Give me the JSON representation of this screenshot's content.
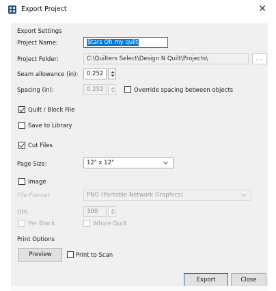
{
  "window": {
    "title": "Export Project",
    "close_glyph": "✕"
  },
  "export_settings": {
    "heading": "Export Settings",
    "project_name": {
      "label": "Project Name:",
      "value": "Stars Oh my quilt"
    },
    "project_folder": {
      "label": "Project Folder:",
      "value": "C:\\Quilters Select\\Design N Quilt\\Projects\\",
      "browse_label": "..."
    },
    "seam_allowance": {
      "label": "Seam allowance (in):",
      "value": "0.252"
    },
    "spacing": {
      "label": "Spacing (in):",
      "value": "0.252"
    },
    "override_spacing": {
      "label": "Override spacing between objects",
      "checked": false
    }
  },
  "quilt_block_file": {
    "label": "Quilt / Block File",
    "checked": true
  },
  "save_to_library": {
    "label": "Save to Library",
    "checked": false
  },
  "cut_files": {
    "label": "Cut Files",
    "checked": true,
    "page_size": {
      "label": "Page Size:",
      "value": "12\" x 12\""
    }
  },
  "image": {
    "label": "Image",
    "checked": false,
    "file_format": {
      "label": "File Format:",
      "value": "PNG (Portable Network Graphics)"
    },
    "dpi": {
      "label": "DPI:",
      "value": "300"
    },
    "per_block": {
      "label": "Per Block",
      "checked": false
    },
    "whole_quilt": {
      "label": "Whole Quilt",
      "checked": false
    }
  },
  "print_options": {
    "heading": "Print Options",
    "preview_label": "Preview",
    "print_to_scan": {
      "label": "Print to Scan",
      "checked": false
    }
  },
  "footer": {
    "export_label": "Export",
    "close_label": "Close"
  }
}
